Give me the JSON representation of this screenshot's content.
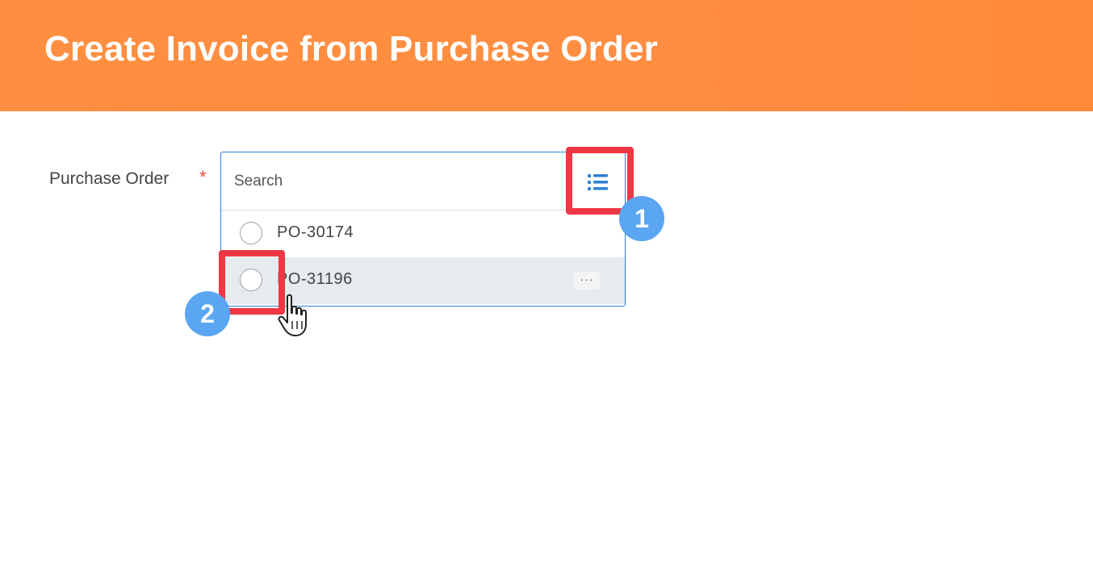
{
  "header": {
    "title": "Create Invoice from Purchase Order"
  },
  "form": {
    "field_label": "Purchase Order",
    "required_marker": "*",
    "search": {
      "placeholder": "Search",
      "value": ""
    },
    "list_icon": "list-icon",
    "options": [
      {
        "label": "PO-30174",
        "selected": false
      },
      {
        "label": "PO-31196",
        "selected": false,
        "hovered": true,
        "related_actions": "···"
      }
    ]
  },
  "annotations": [
    {
      "number": "1",
      "target": "list-icon"
    },
    {
      "number": "2",
      "target": "radio PO-31196"
    }
  ],
  "colors": {
    "header_bg": "#ff8d42",
    "accent_blue": "#2f7fd8",
    "highlight_red": "#ef3844",
    "badge_blue": "#5aa6f2",
    "required_red": "#e74c3c"
  }
}
